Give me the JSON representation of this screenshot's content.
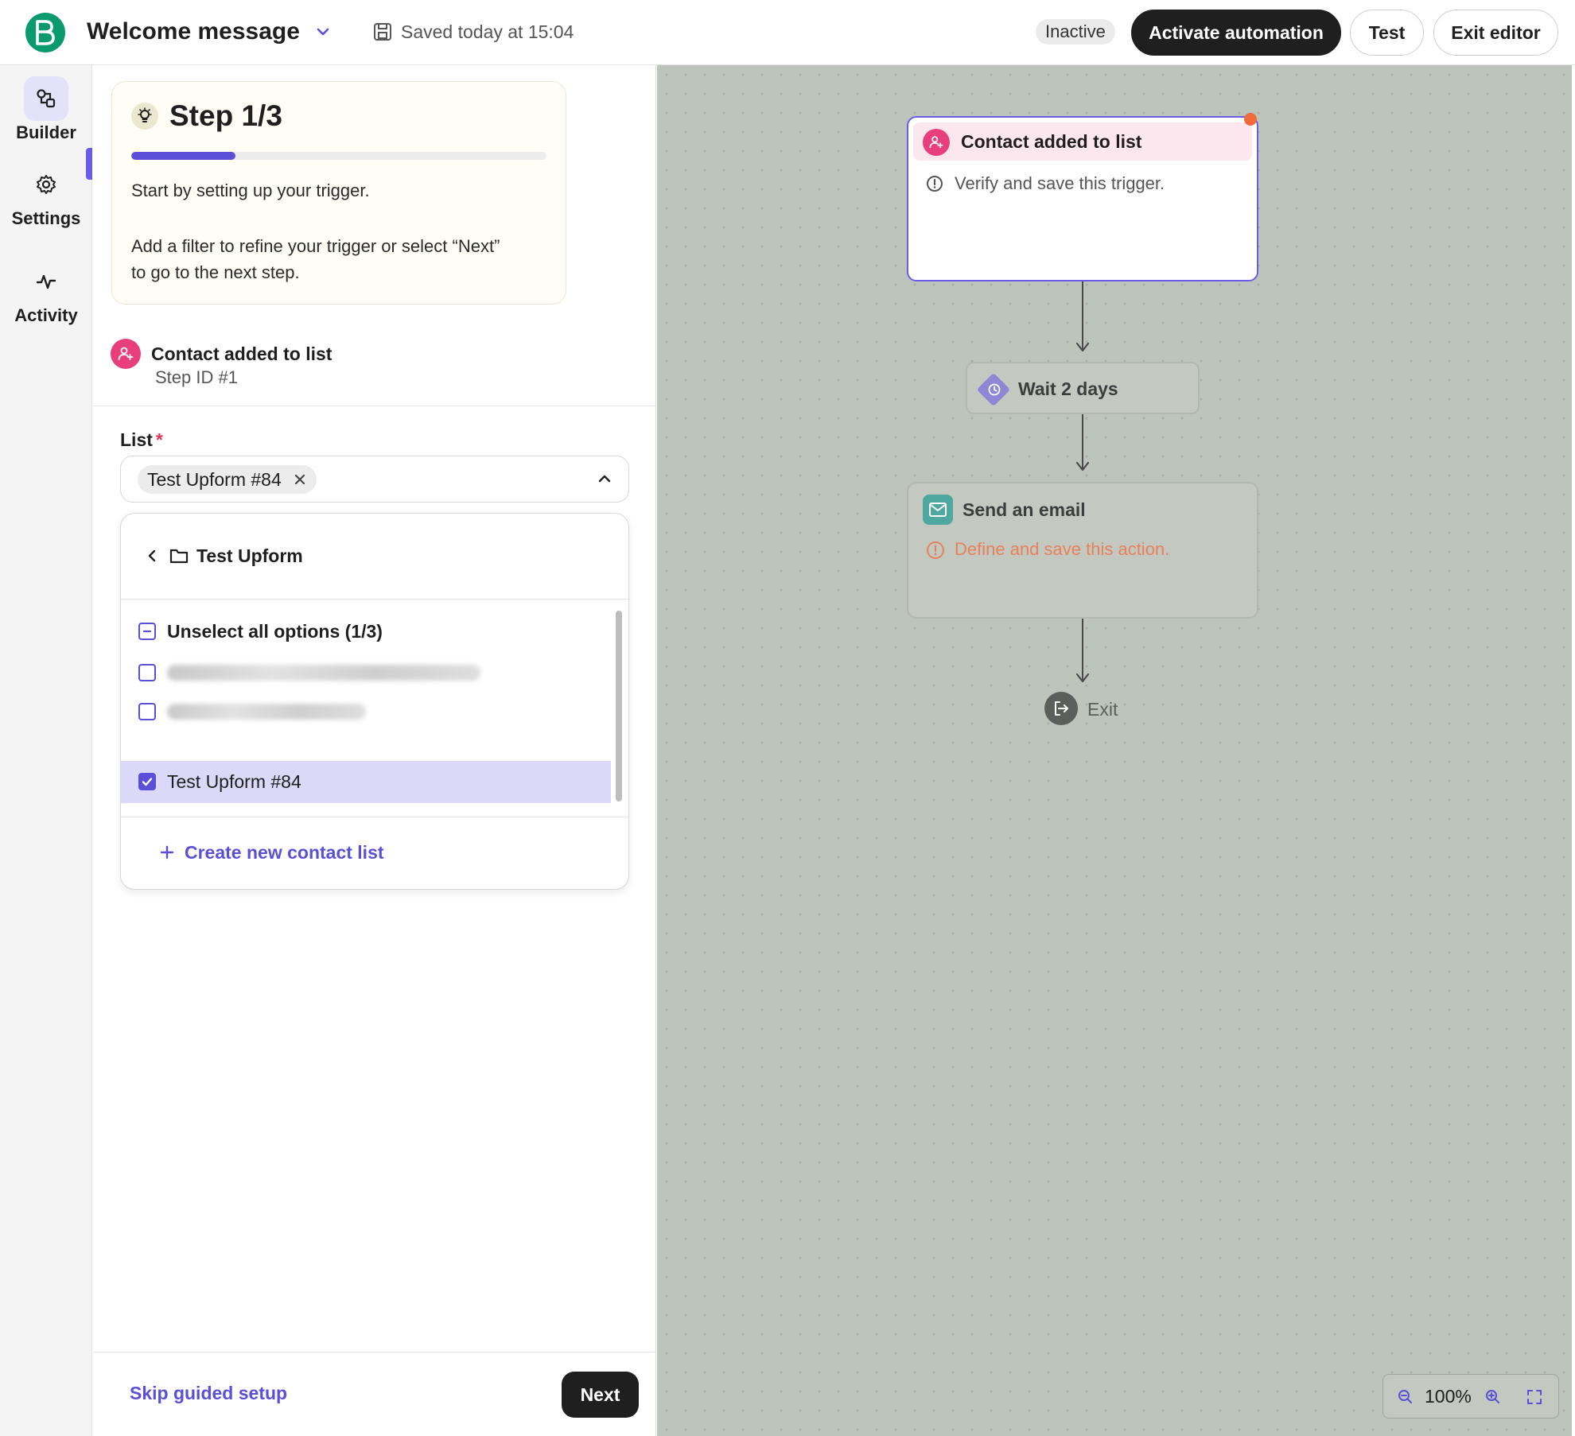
{
  "header": {
    "title": "Welcome message",
    "save_status": "Saved today at 15:04",
    "status_badge": "Inactive",
    "activate_label": "Activate automation",
    "test_label": "Test",
    "exit_label": "Exit editor"
  },
  "nav": {
    "items": [
      {
        "label": "Builder",
        "icon": "builder-icon",
        "active": true
      },
      {
        "label": "Settings",
        "icon": "gear-icon",
        "active": false
      },
      {
        "label": "Activity",
        "icon": "activity-icon",
        "active": false
      }
    ]
  },
  "guide": {
    "title": "Step 1/3",
    "progress": 0.25,
    "text1": "Start by setting up your trigger.",
    "text2": "Add a filter to refine your trigger or select “Next” to go to the next step."
  },
  "trigger": {
    "name": "Contact added to list",
    "step_id": "Step ID #1"
  },
  "list_field": {
    "label": "List",
    "required_mark": "*",
    "selected_chip": "Test Upform #84"
  },
  "dropdown": {
    "folder": "Test Upform",
    "unselect_all": "Unselect all options (1/3)",
    "options": [
      {
        "label": "",
        "checked": false,
        "redacted": true
      },
      {
        "label": "",
        "checked": false,
        "redacted": true
      },
      {
        "label": "Test Upform #84",
        "checked": true,
        "redacted": false
      }
    ],
    "create_label": "Create new contact list"
  },
  "footer": {
    "skip_label": "Skip guided setup",
    "next_label": "Next"
  },
  "canvas": {
    "trigger_node": {
      "title": "Contact added to list",
      "message": "Verify and save this trigger."
    },
    "wait_node": {
      "title": "Wait 2 days"
    },
    "email_node": {
      "title": "Send an email",
      "message": "Define and save this action."
    },
    "exit_label": "Exit",
    "zoom_level": "100%"
  },
  "colors": {
    "accent": "#5a4fd6",
    "brand": "#0b996e",
    "trigger_pink": "#e83e7b",
    "warning": "#e8805a",
    "dark_button": "#1f1f1f"
  }
}
